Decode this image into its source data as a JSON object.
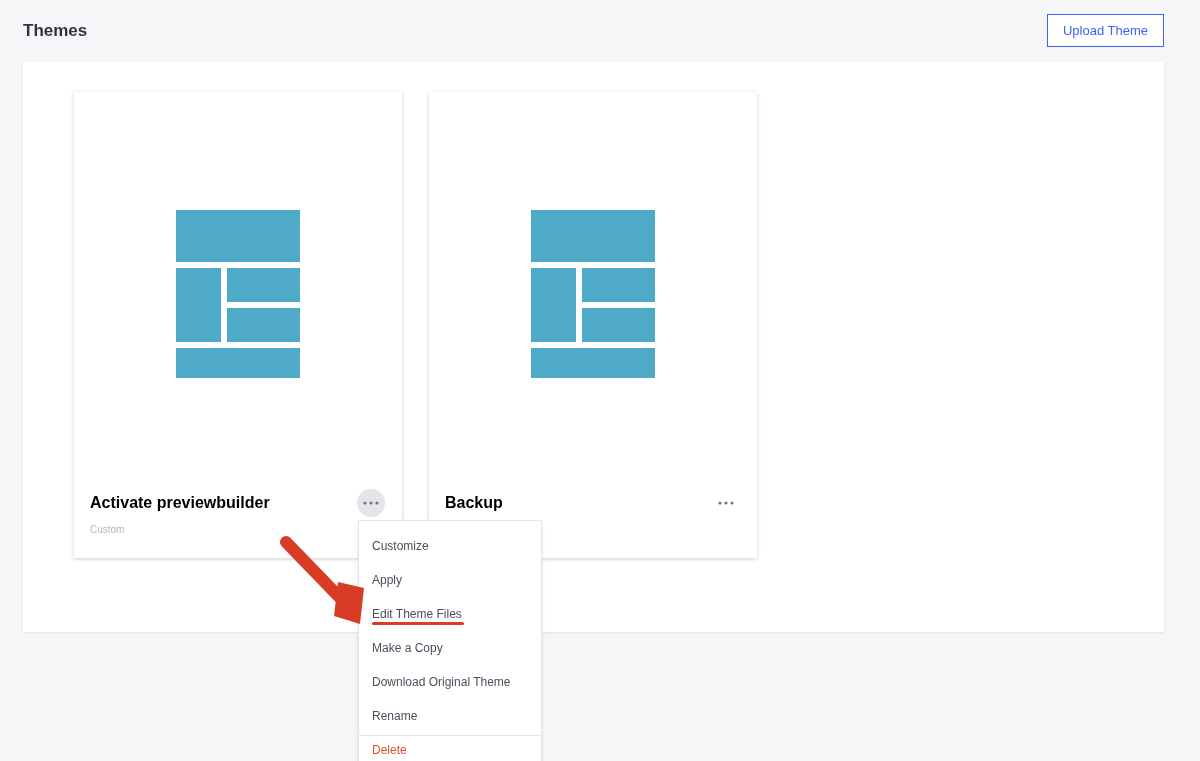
{
  "page": {
    "title": "Themes"
  },
  "upload_button": {
    "label": "Upload Theme"
  },
  "themes": [
    {
      "name": "Activate previewbuilder",
      "type_label": "Custom",
      "menu_open": true
    },
    {
      "name": "Backup",
      "menu_open": false
    }
  ],
  "menu": {
    "items": [
      {
        "label": "Customize",
        "kind": "normal",
        "highlighted": false
      },
      {
        "label": "Apply",
        "kind": "normal",
        "highlighted": false
      },
      {
        "label": "Edit Theme Files",
        "kind": "normal",
        "highlighted": true
      },
      {
        "label": "Make a Copy",
        "kind": "normal",
        "highlighted": false
      },
      {
        "label": "Download Original Theme",
        "kind": "normal",
        "highlighted": false
      },
      {
        "label": "Rename",
        "kind": "normal",
        "highlighted": false
      },
      {
        "label": "Delete",
        "kind": "danger",
        "highlighted": false
      }
    ]
  }
}
